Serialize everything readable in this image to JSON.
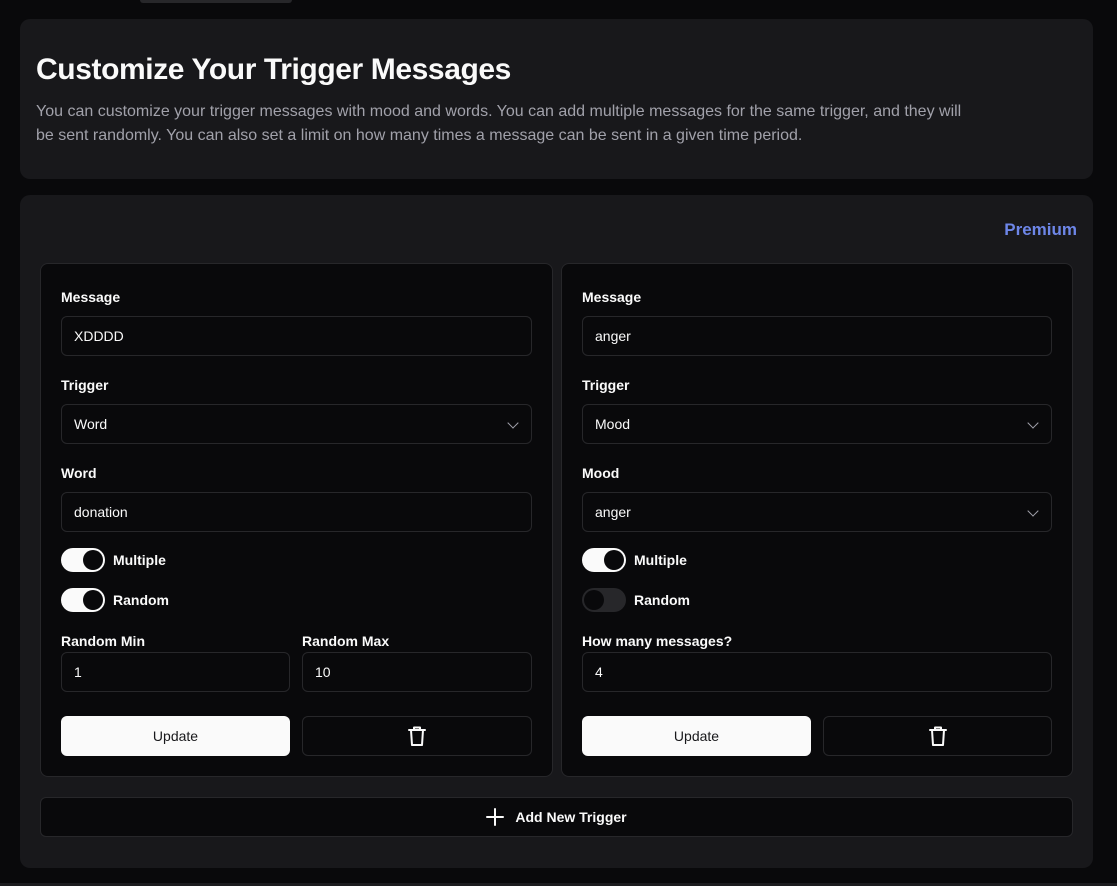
{
  "header": {
    "title": "Customize Your Trigger Messages",
    "description": "You can customize your trigger messages with mood and words. You can add multiple messages for the same trigger, and they will be sent randomly. You can also set a limit on how many times a message can be sent in a given time period."
  },
  "badge": {
    "premium_label": "Premium",
    "color": "#6d86e8"
  },
  "triggers": [
    {
      "message_label": "Message",
      "message_value": "XDDDD",
      "trigger_label": "Trigger",
      "trigger_value": "Word",
      "detail_label": "Word",
      "detail_value": "donation",
      "multiple_label": "Multiple",
      "multiple_on": true,
      "random_label": "Random",
      "random_on": true,
      "random_min_label": "Random Min",
      "random_min_value": "1",
      "random_max_label": "Random Max",
      "random_max_value": "10",
      "update_label": "Update",
      "delete_icon": "trash-icon"
    },
    {
      "message_label": "Message",
      "message_value": "anger",
      "trigger_label": "Trigger",
      "trigger_value": "Mood",
      "detail_label": "Mood",
      "detail_value": "anger",
      "multiple_label": "Multiple",
      "multiple_on": true,
      "random_label": "Random",
      "random_on": false,
      "count_label": "How many messages?",
      "count_value": "4",
      "update_label": "Update",
      "delete_icon": "trash-icon"
    }
  ],
  "add_trigger": {
    "label": "Add New Trigger",
    "icon": "plus-icon"
  }
}
